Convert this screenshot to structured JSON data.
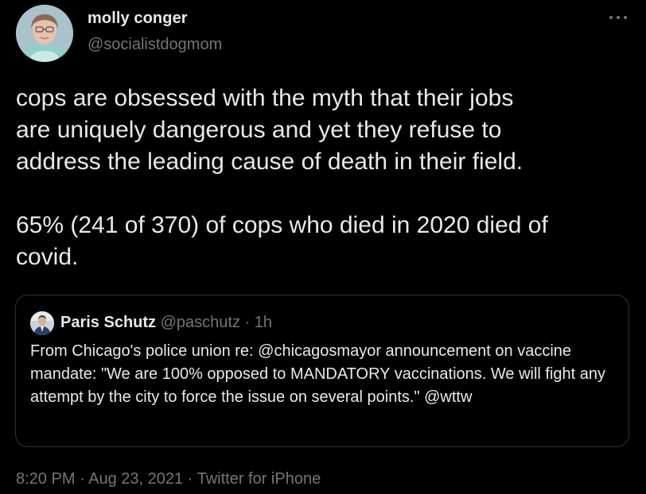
{
  "author": {
    "display_name": "molly conger",
    "handle": "@socialistdogmom",
    "avatar_icon": "profile-photo"
  },
  "more_icon": "more-options-icon",
  "tweet": {
    "text": "cops are obsessed with the myth that their jobs\nare uniquely dangerous and yet they refuse to\naddress the leading cause of death in their field.\n\n65% (241 of 370) of cops who died in 2020 died of\ncovid."
  },
  "quoted_tweet": {
    "display_name": "Paris Schutz",
    "handle": "@paschutz",
    "separator": "·",
    "time": "1h",
    "text": "From Chicago's police union re: @chicagosmayor announcement on vaccine mandate: \"We are 100% opposed to MANDATORY vaccinations.  We will fight any attempt by the city to force the issue on several points.\" @wttw"
  },
  "meta": {
    "time": "8:20 PM",
    "separator1": " · ",
    "date": "Aug 23, 2021",
    "separator2": " · ",
    "source": "Twitter for iPhone"
  },
  "colors": {
    "background": "#000000",
    "primary_text": "#e7e9ea",
    "secondary_text": "#71767b",
    "border": "#2f3336"
  }
}
